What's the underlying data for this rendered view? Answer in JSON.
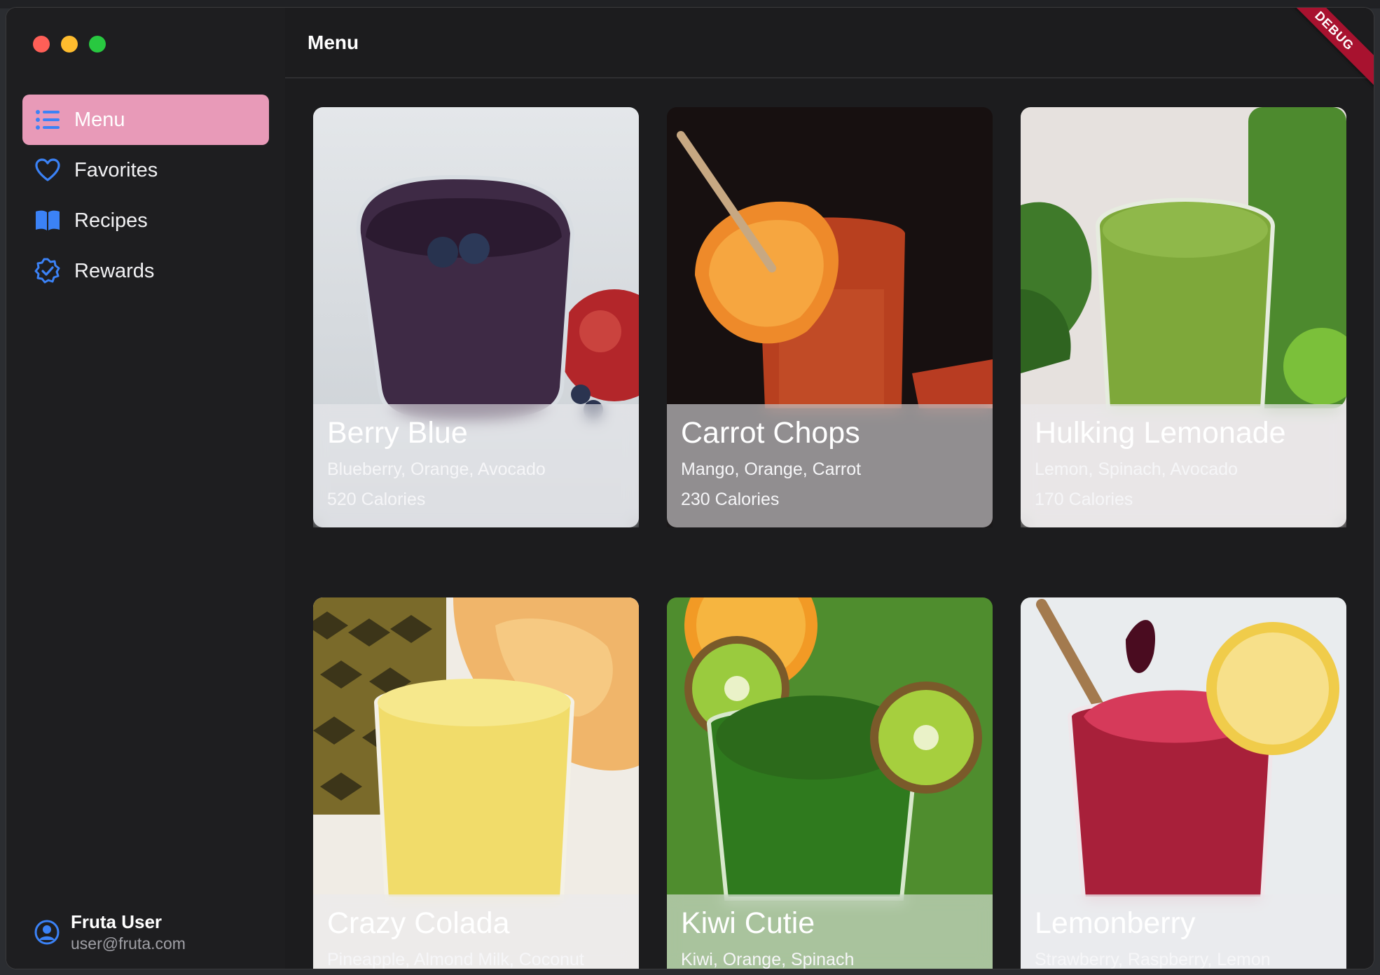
{
  "window": {
    "traffic_lights": {
      "close": "#ff5f57",
      "minimize": "#febc2e",
      "zoom": "#28c840"
    }
  },
  "sidebar": {
    "items": [
      {
        "label": "Menu",
        "icon": "list-icon",
        "active": true
      },
      {
        "label": "Favorites",
        "icon": "heart-icon",
        "active": false
      },
      {
        "label": "Recipes",
        "icon": "book-icon",
        "active": false
      },
      {
        "label": "Rewards",
        "icon": "badge-check-icon",
        "active": false
      }
    ],
    "accent_color": "#e89ab8",
    "icon_color": "#3b82f6",
    "user": {
      "name": "Fruta User",
      "email": "user@fruta.com",
      "icon": "user-circle-icon"
    }
  },
  "toolbar": {
    "title": "Menu"
  },
  "debug_banner": {
    "label": "DEBUG",
    "color": "#a8122f"
  },
  "drinks": [
    {
      "name": "Berry Blue",
      "ingredients": "Blueberry, Orange, Avocado",
      "calories": "520 Calories"
    },
    {
      "name": "Carrot Chops",
      "ingredients": "Mango, Orange, Carrot",
      "calories": "230 Calories"
    },
    {
      "name": "Hulking Lemonade",
      "ingredients": "Lemon, Spinach, Avocado",
      "calories": "170 Calories"
    },
    {
      "name": "Crazy Colada",
      "ingredients": "Pineapple, Almond Milk, Coconut",
      "calories": ""
    },
    {
      "name": "Kiwi Cutie",
      "ingredients": "Kiwi, Orange, Spinach",
      "calories": ""
    },
    {
      "name": "Lemonberry",
      "ingredients": "Strawberry, Raspberry, Lemon",
      "calories": ""
    }
  ]
}
